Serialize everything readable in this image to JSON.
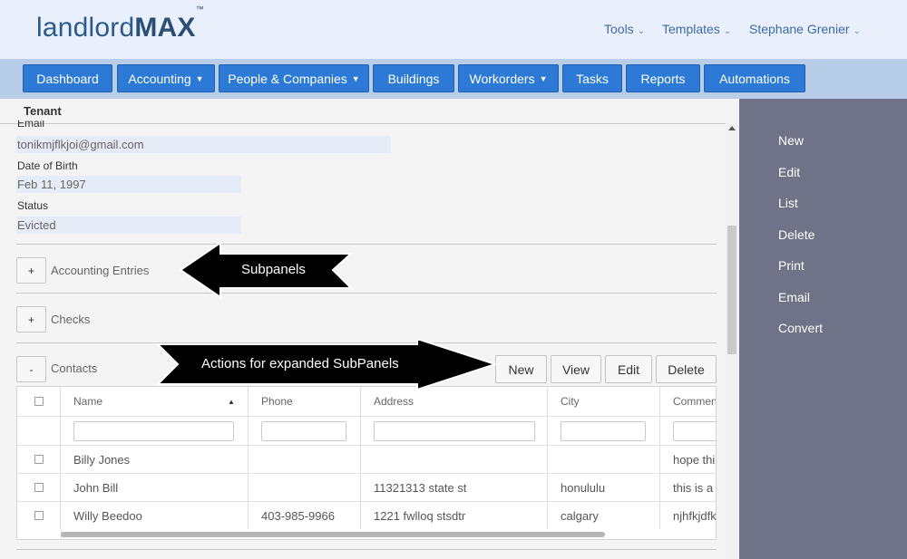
{
  "app": {
    "logo_light": "landlord",
    "logo_bold": "MAX",
    "logo_tm": "™"
  },
  "top_menu": [
    {
      "label": "Tools"
    },
    {
      "label": "Templates"
    },
    {
      "label": "Stephane Grenier"
    }
  ],
  "nav": [
    {
      "label": "Dashboard"
    },
    {
      "label": "Accounting"
    },
    {
      "label": "People & Companies"
    },
    {
      "label": "Buildings"
    },
    {
      "label": "Workorders"
    },
    {
      "label": "Tasks"
    },
    {
      "label": "Reports"
    },
    {
      "label": "Automations"
    }
  ],
  "record": {
    "title": "Tenant",
    "email_label": "Email",
    "email_value": "tonikmjflkjoi@gmail.com",
    "dob_label": "Date of Birth",
    "dob_value": "Feb 11, 1997",
    "status_label": "Status",
    "status_value": "Evicted"
  },
  "subpanels": [
    {
      "toggle": "+",
      "title": "Accounting Entries"
    },
    {
      "toggle": "+",
      "title": "Checks"
    },
    {
      "toggle": "-",
      "title": "Contacts"
    }
  ],
  "contacts_actions": [
    {
      "label": "New"
    },
    {
      "label": "View"
    },
    {
      "label": "Edit"
    },
    {
      "label": "Delete"
    }
  ],
  "contacts_grid": {
    "columns": [
      "Name",
      "Phone",
      "Address",
      "City",
      "Commen"
    ],
    "sort_indicator": "▲",
    "rows": [
      {
        "name": "Billy Jones",
        "phone": "",
        "address": "",
        "city": "",
        "comment": "hope thi"
      },
      {
        "name": "John Bill",
        "phone": "",
        "address": "11321313 state st",
        "city": "honululu",
        "comment": "this is a"
      },
      {
        "name": "Willy Beedoo",
        "phone": "403-985-9966",
        "address": "1221 fwlloq stsdtr",
        "city": "calgary",
        "comment": "njhfkjdfk"
      }
    ]
  },
  "sidebar": [
    {
      "label": "New"
    },
    {
      "label": "Edit"
    },
    {
      "label": "List"
    },
    {
      "label": "Delete"
    },
    {
      "label": "Print"
    },
    {
      "label": "Email"
    },
    {
      "label": "Convert"
    }
  ],
  "annotations": {
    "subpanels": "Subpanels",
    "actions": "Actions for expanded SubPanels"
  },
  "colors": {
    "nav_button": "#2d7ad6",
    "header_bg": "#e9f0fb",
    "sidebar_bg": "#707287"
  }
}
